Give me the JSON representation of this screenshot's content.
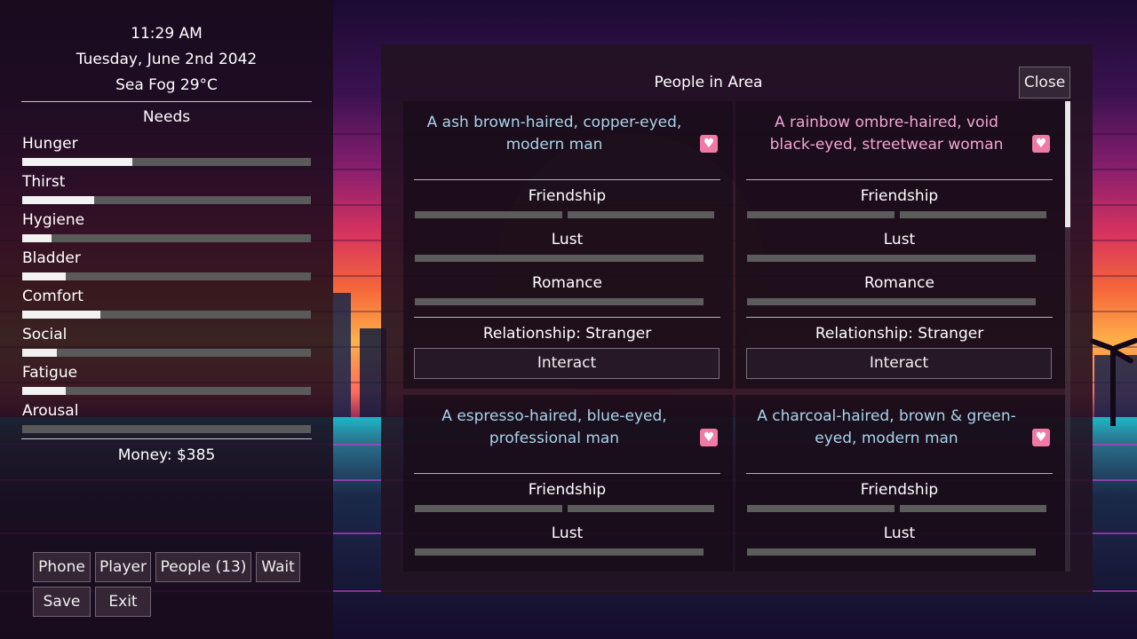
{
  "header": {
    "time": "11:29 AM",
    "date": "Tuesday, June 2nd 2042",
    "weather": "Sea Fog 29°C"
  },
  "needs": {
    "title": "Needs",
    "items": [
      {
        "label": "Hunger",
        "level": 0.38
      },
      {
        "label": "Thirst",
        "level": 0.25
      },
      {
        "label": "Hygiene",
        "level": 0.1
      },
      {
        "label": "Bladder",
        "level": 0.15
      },
      {
        "label": "Comfort",
        "level": 0.27
      },
      {
        "label": "Social",
        "level": 0.12
      },
      {
        "label": "Fatigue",
        "level": 0.15
      },
      {
        "label": "Arousal",
        "level": 0.0
      }
    ]
  },
  "money": "Money: $385",
  "menu": {
    "phone": "Phone",
    "player": "Player",
    "people": "People (13)",
    "wait": "Wait",
    "save": "Save",
    "exit": "Exit"
  },
  "people_panel": {
    "title": "People in Area",
    "close": "Close",
    "cards": [
      {
        "description": "A ash brown-haired, copper-eyed, modern man",
        "friendship_label": "Friendship",
        "lust_label": "Lust",
        "romance_label": "Romance",
        "relationship": "Relationship: Stranger",
        "interact": "Interact"
      },
      {
        "description": "A rainbow ombre-haired, void black-eyed, streetwear woman",
        "friendship_label": "Friendship",
        "lust_label": "Lust",
        "romance_label": "Romance",
        "relationship": "Relationship: Stranger",
        "interact": "Interact"
      },
      {
        "description": "A espresso-haired, blue-eyed, professional man",
        "friendship_label": "Friendship",
        "lust_label": "Lust"
      },
      {
        "description": "A charcoal-haired, brown & green-eyed, modern man",
        "friendship_label": "Friendship",
        "lust_label": "Lust"
      }
    ]
  },
  "colors": {
    "description_man": "#a9d4ea",
    "description_woman": "#f3a6d6",
    "heart_icon": "#f07aa6",
    "need_fill": "#f2f2f2",
    "bar_empty": "#5a5a5a"
  }
}
